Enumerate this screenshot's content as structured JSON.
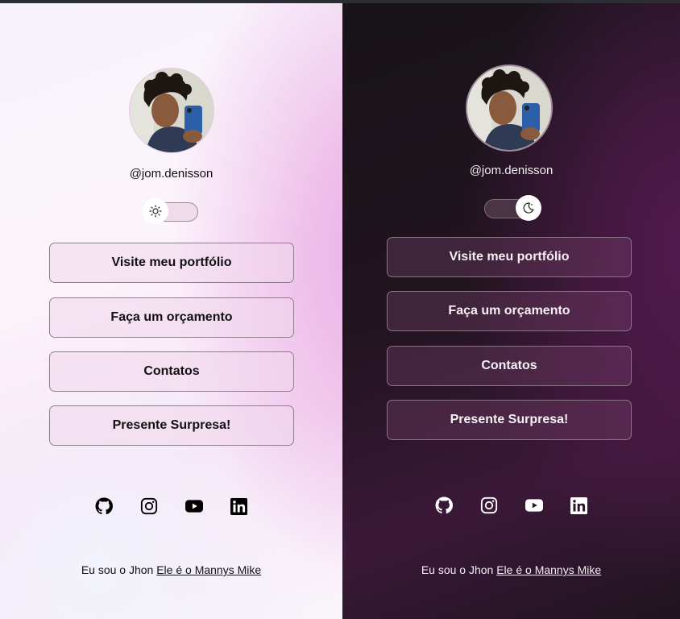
{
  "profile": {
    "handle": "@jom.denisson",
    "avatar_alt": "avatar"
  },
  "buttons": [
    {
      "label": "Visite meu portfólio"
    },
    {
      "label": "Faça um orçamento"
    },
    {
      "label": "Contatos"
    },
    {
      "label": "Presente Surpresa!"
    }
  ],
  "theme_toggle": {
    "light_icon": "sun-icon",
    "dark_icon": "moon-icon"
  },
  "socials": [
    "github-icon",
    "instagram-icon",
    "youtube-icon",
    "linkedin-icon"
  ],
  "footer": {
    "text": "Eu sou o Jhon",
    "link_text": "Ele é o Mannys Mike"
  },
  "colors": {
    "light_accent": "#eab0e6",
    "dark_accent": "#511a4e"
  }
}
